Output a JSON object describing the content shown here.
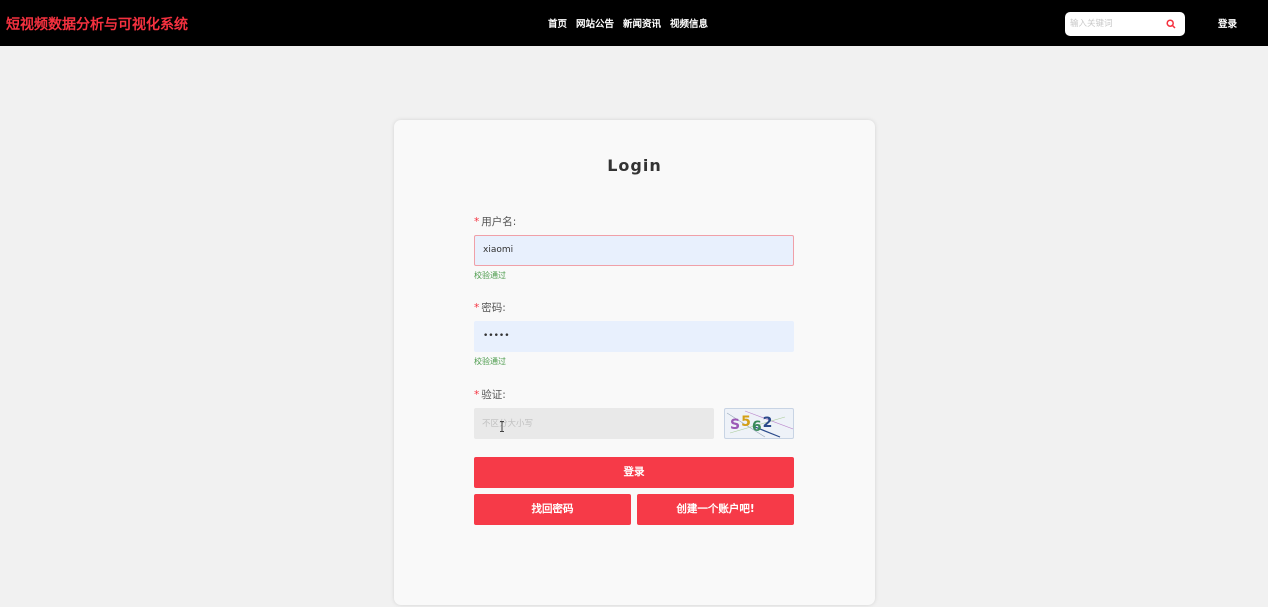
{
  "header": {
    "brand": "短视频数据分析与可视化系统",
    "nav": [
      "首页",
      "网站公告",
      "新闻资讯",
      "视频信息"
    ],
    "search_placeholder": "输入关键词",
    "login_link": "登录"
  },
  "form": {
    "title": "Login",
    "username": {
      "required_mark": "*",
      "label": "用户名:",
      "value": "xiaomi",
      "hint": "校验通过"
    },
    "password": {
      "required_mark": "*",
      "label": "密码:",
      "value": "•••••",
      "hint": "校验通过"
    },
    "captcha": {
      "required_mark": "*",
      "label": "验证:",
      "placeholder": "不区分大小写",
      "code": "S562"
    },
    "buttons": {
      "login": "登录",
      "find_password": "找回密码",
      "create_account": "创建一个账户吧!"
    }
  },
  "colors": {
    "brand": "#f5313f",
    "button": "#f63a48",
    "valid_hint": "#4a9a4a"
  }
}
